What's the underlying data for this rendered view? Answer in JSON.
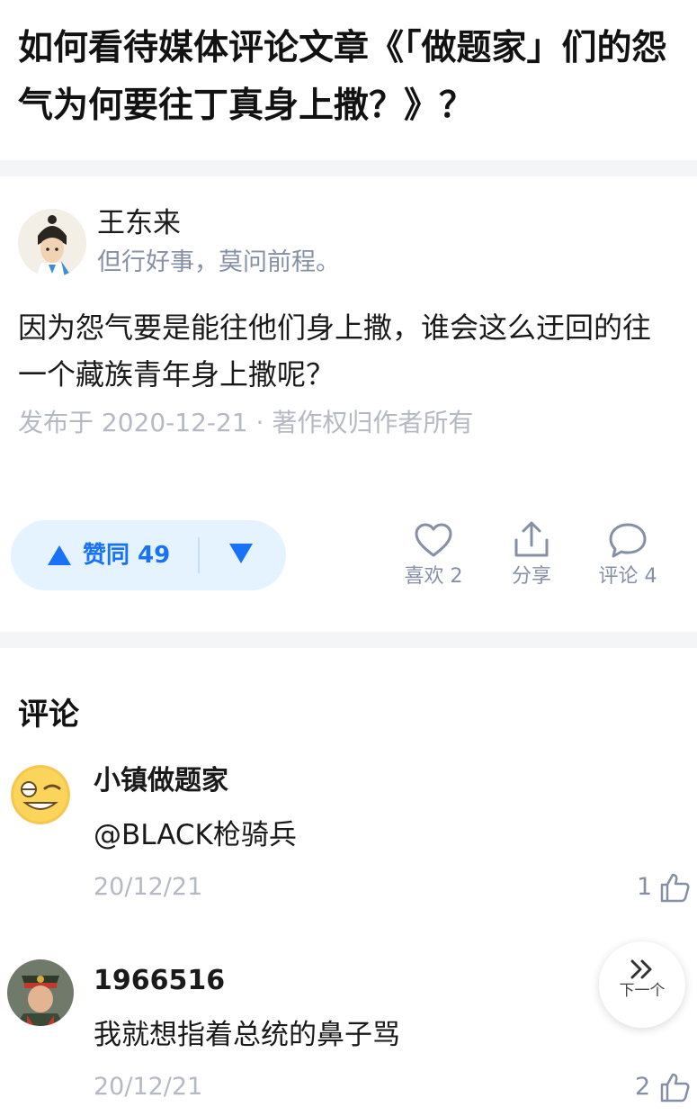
{
  "question": {
    "title": "如何看待媒体评论文章《「做题家」们的怨气为何要往丁真身上撒？》？"
  },
  "answer": {
    "author_name": "王东来",
    "author_bio": "但行好事，莫问前程。",
    "content": "因为怨气要是能往他们身上撒，谁会这么迂回的往一个藏族青年身上撒呢？",
    "meta": "发布于 2020-12-21 · 著作权归作者所有"
  },
  "actions": {
    "vote_label": "赞同 49",
    "like_label": "喜欢 2",
    "share_label": "分享",
    "comment_label": "评论 4"
  },
  "comments": {
    "title": "评论",
    "items": [
      {
        "name": "小镇做题家",
        "text": "@BLACK枪骑兵",
        "date": "20/12/21",
        "likes": "1"
      },
      {
        "name": "1966516",
        "text": "我就想指着总统的鼻子骂",
        "date": "20/12/21",
        "likes": "2"
      }
    ]
  },
  "next_button": {
    "label": "下一个"
  },
  "colors": {
    "accent": "#1772f6",
    "vote_bg": "#e5f2ff",
    "muted": "#8590a6",
    "meta": "#b4b9c3"
  }
}
